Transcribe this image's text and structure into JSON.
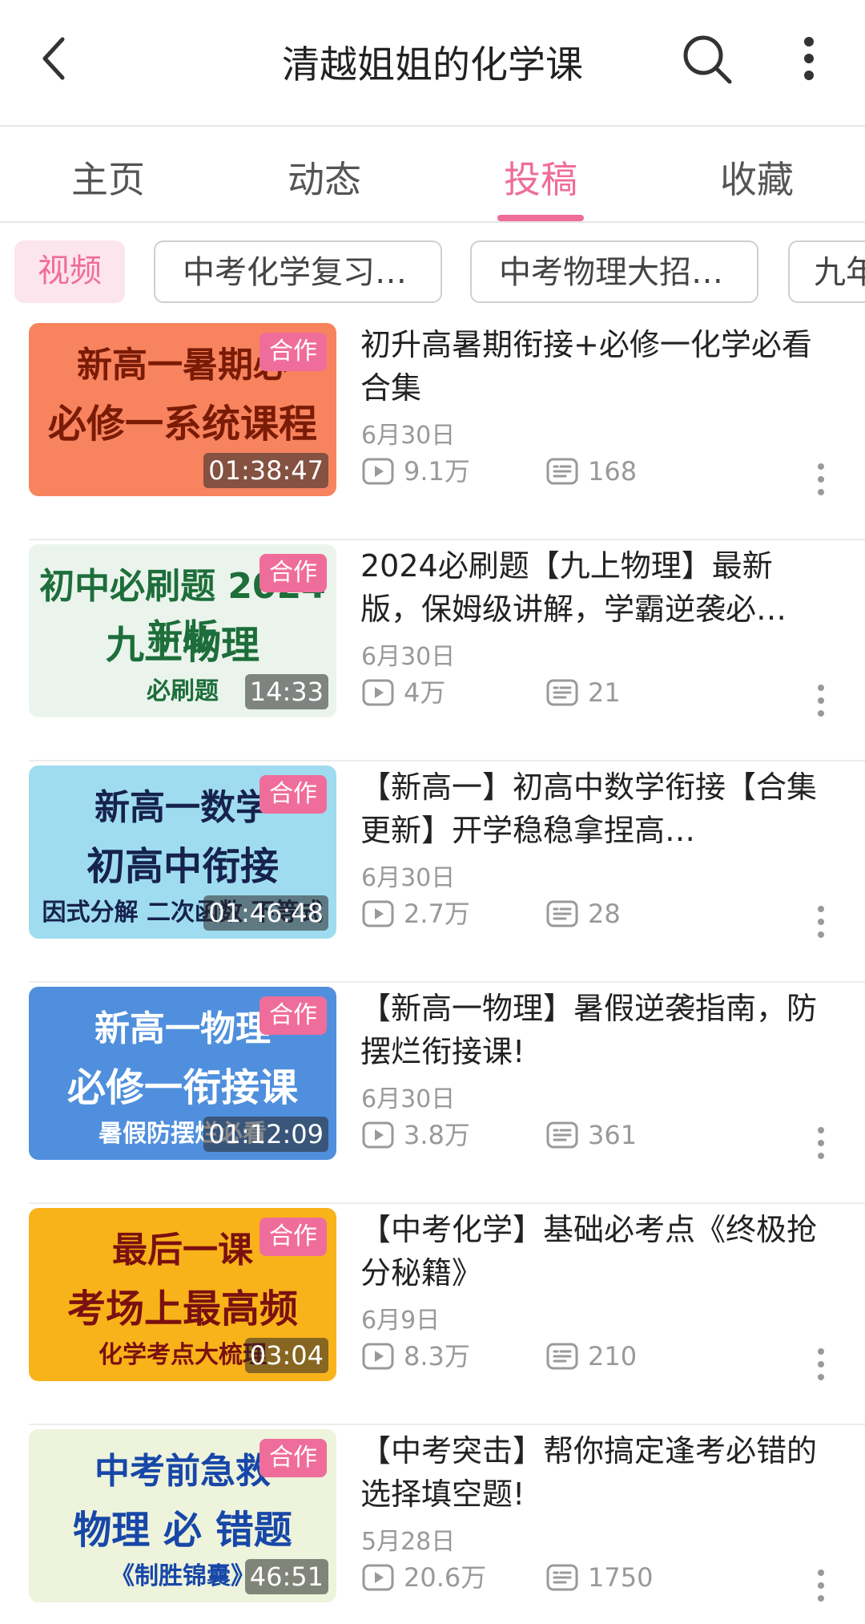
{
  "header": {
    "title": "清越姐姐的化学课",
    "back_icon": "chevron-left-icon",
    "search_icon": "search-icon",
    "more_icon": "more-vertical-icon"
  },
  "tabs": [
    {
      "label": "主页",
      "active": false
    },
    {
      "label": "动态",
      "active": false
    },
    {
      "label": "投稿",
      "active": true
    },
    {
      "label": "收藏",
      "active": false
    }
  ],
  "filters": [
    {
      "label": "视频",
      "selected": true
    },
    {
      "label": "中考化学复习…",
      "selected": false
    },
    {
      "label": "中考物理大招…",
      "selected": false
    },
    {
      "label": "九年",
      "selected": false
    }
  ],
  "accent_color": "#ef6d9a",
  "videos": [
    {
      "title": "初升高暑期衔接+必修一化学必看合集",
      "date": "6月30日",
      "plays": "9.1万",
      "danmaku": "168",
      "duration": "01:38:47",
      "badge": "合作",
      "thumb": {
        "lines": [
          "新高一暑期必",
          "必修一系统课程",
          ""
        ],
        "bg": "#f7845f",
        "fg": "#7a1b06"
      }
    },
    {
      "title": "2024必刷题【九上物理】最新版，保姆级讲解，学霸逆袭必…",
      "date": "6月30日",
      "plays": "4万",
      "danmaku": "21",
      "duration": "14:33",
      "badge": "合作",
      "thumb": {
        "lines": [
          "初中必刷题  2024新版",
          "九上物理",
          "必刷题"
        ],
        "bg": "#eaf4ec",
        "fg": "#1d6e3a"
      }
    },
    {
      "title": "【新高一】初高中数学衔接【合集更新】开学稳稳拿捏高…",
      "date": "6月30日",
      "plays": "2.7万",
      "danmaku": "28",
      "duration": "01:46:48",
      "badge": "合作",
      "thumb": {
        "lines": [
          "新高一数学",
          "初高中衔接",
          "因式分解 二次函数 不等式"
        ],
        "bg": "#9fdcef",
        "fg": "#16224d"
      }
    },
    {
      "title": "【新高一物理】暑假逆袭指南，防摆烂衔接课!",
      "date": "6月30日",
      "plays": "3.8万",
      "danmaku": "361",
      "duration": "01:12:09",
      "badge": "合作",
      "thumb": {
        "lines": [
          "新高一物理",
          "必修一衔接课",
          "暑假防摆烂必看"
        ],
        "bg": "#4f8fdd",
        "fg": "#ffffff"
      }
    },
    {
      "title": "【中考化学】基础必考点《终极抢分秘籍》",
      "date": "6月9日",
      "plays": "8.3万",
      "danmaku": "210",
      "duration": "03:04",
      "badge": "合作",
      "thumb": {
        "lines": [
          "最后一课",
          "考场上最高频",
          "化学考点大梳理"
        ],
        "bg": "#f8b21a",
        "fg": "#7a1010"
      }
    },
    {
      "title": "【中考突击】帮你搞定逢考必错的选择填空题!",
      "date": "5月28日",
      "plays": "20.6万",
      "danmaku": "1750",
      "duration": "46:51",
      "badge": "合作",
      "thumb": {
        "lines": [
          "中考前急救",
          "物理 必 错题",
          "《制胜锦囊》"
        ],
        "bg": "#eef3dc",
        "fg": "#1747a8"
      }
    }
  ]
}
